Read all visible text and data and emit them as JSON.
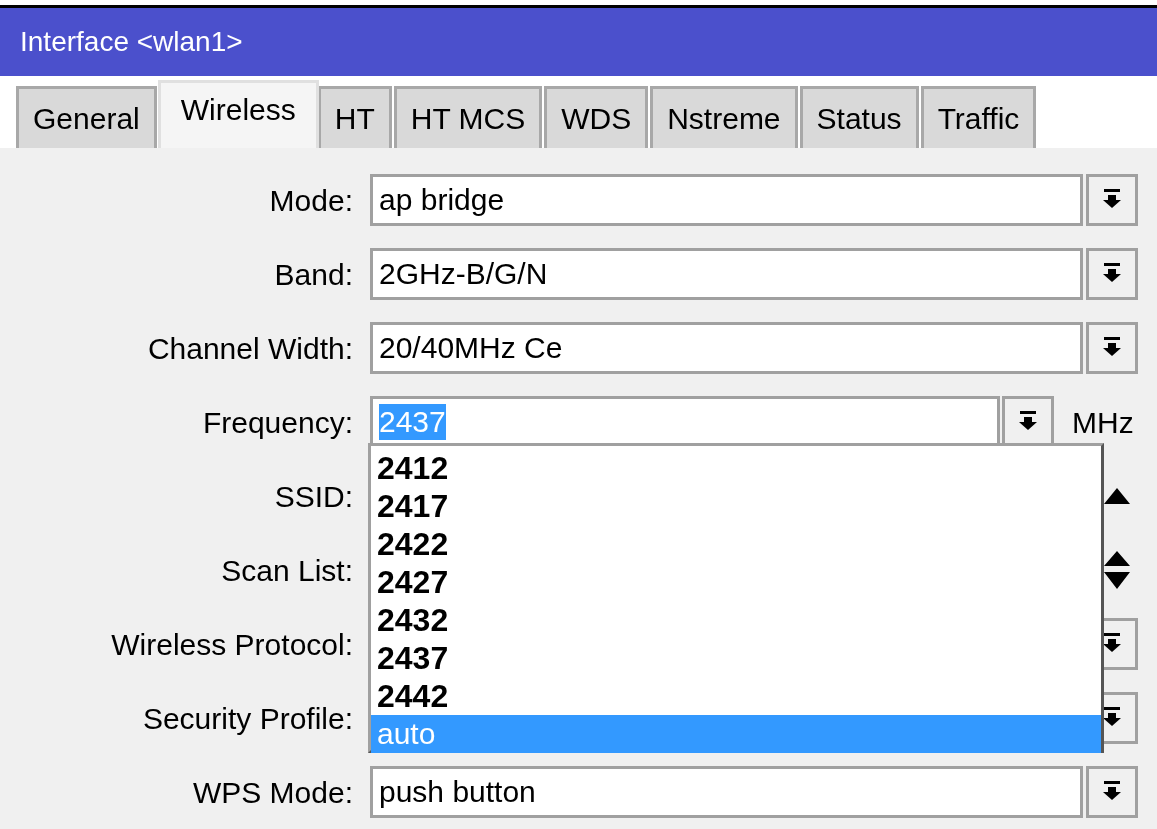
{
  "window": {
    "title": "Interface <wlan1>"
  },
  "tabs": [
    {
      "label": "General",
      "selected": false
    },
    {
      "label": "Wireless",
      "selected": true
    },
    {
      "label": "HT",
      "selected": false
    },
    {
      "label": "HT MCS",
      "selected": false
    },
    {
      "label": "WDS",
      "selected": false
    },
    {
      "label": "Nstreme",
      "selected": false
    },
    {
      "label": "Status",
      "selected": false
    },
    {
      "label": "Traffic",
      "selected": false
    }
  ],
  "fields": [
    {
      "label": "Mode:",
      "kind": "combo",
      "value": "ap bridge"
    },
    {
      "label": "Band:",
      "kind": "combo",
      "value": "2GHz-B/G/N"
    },
    {
      "label": "Channel Width:",
      "kind": "combo",
      "value": "20/40MHz Ce"
    },
    {
      "label": "Frequency:",
      "kind": "combo_unit",
      "value": "2437",
      "value_highlighted": true,
      "unit": "MHz"
    },
    {
      "label": "SSID:",
      "kind": "text_up"
    },
    {
      "label": "Scan List:",
      "kind": "list_updown"
    },
    {
      "label": "Wireless Protocol:",
      "kind": "covered_combo"
    },
    {
      "label": "Security Profile:",
      "kind": "covered_combo"
    },
    {
      "label": "WPS Mode:",
      "kind": "combo",
      "value": "push button"
    }
  ],
  "dropdown": {
    "options": [
      {
        "label": "2412",
        "selected": false
      },
      {
        "label": "2417",
        "selected": false
      },
      {
        "label": "2422",
        "selected": false
      },
      {
        "label": "2427",
        "selected": false
      },
      {
        "label": "2432",
        "selected": false
      },
      {
        "label": "2437",
        "selected": false
      },
      {
        "label": "2442",
        "selected": false
      },
      {
        "label": "auto",
        "selected": true
      }
    ]
  }
}
